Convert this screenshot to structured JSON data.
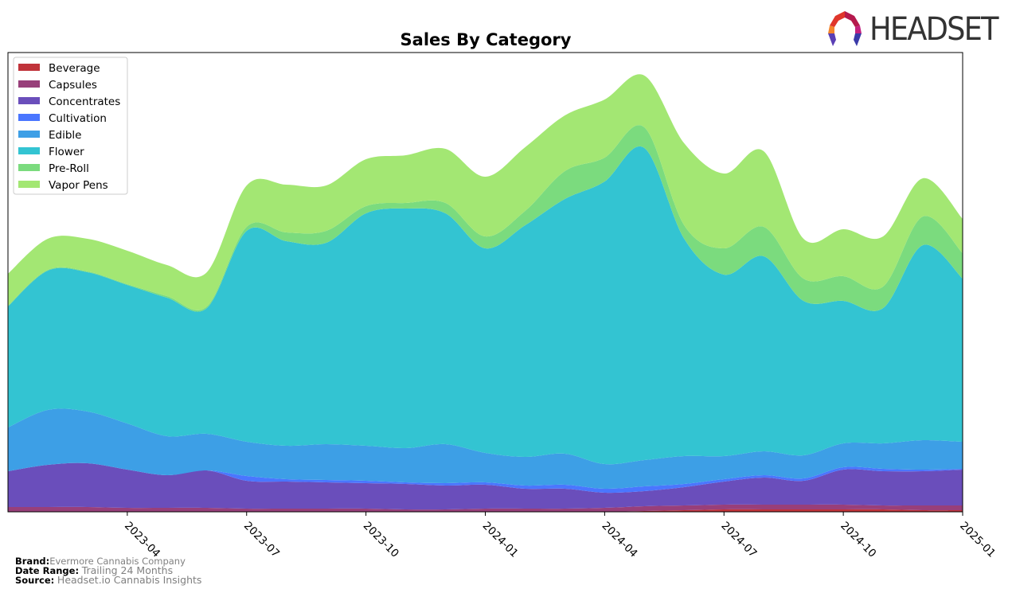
{
  "logo": {
    "text": "HEADSET",
    "icon": "headset-logo-icon"
  },
  "footer": {
    "brand_label": "Brand:",
    "brand_value": "Evermore Cannabis Company",
    "date_label": "Date Range:",
    "date_value": "Trailing 24 Months",
    "source_label": "Source:",
    "source_value": "Headset.io Cannabis Insights"
  },
  "chart_data": {
    "type": "area",
    "stacked": true,
    "title": "Sales By Category",
    "xlabel": "",
    "ylabel": "",
    "y_units": "relative (no y-axis shown)",
    "grid": false,
    "legend_position": "top-left",
    "x": [
      "2023-01",
      "2023-02",
      "2023-03",
      "2023-04",
      "2023-05",
      "2023-06",
      "2023-07",
      "2023-08",
      "2023-09",
      "2023-10",
      "2023-11",
      "2023-12",
      "2024-01",
      "2024-02",
      "2024-03",
      "2024-04",
      "2024-05",
      "2024-06",
      "2024-07",
      "2024-08",
      "2024-09",
      "2024-10",
      "2024-11",
      "2024-12",
      "2025-01"
    ],
    "x_tick_labels": [
      "2023-04",
      "2023-07",
      "2023-10",
      "2024-01",
      "2024-04",
      "2024-07",
      "2024-10",
      "2025-01"
    ],
    "ylim": [
      0,
      577
    ],
    "series": [
      {
        "name": "Beverage",
        "color": "#c0333a",
        "values": [
          0,
          0,
          0,
          0,
          0,
          0,
          0,
          0,
          0,
          0,
          0,
          0,
          0,
          0,
          0,
          0,
          1,
          2,
          3,
          3,
          3,
          3,
          3,
          2,
          2
        ]
      },
      {
        "name": "Capsules",
        "color": "#983f7a",
        "values": [
          6,
          6,
          6,
          5,
          5,
          5,
          4,
          4,
          4,
          4,
          3,
          3,
          4,
          4,
          4,
          5,
          6,
          6,
          6,
          6,
          6,
          6,
          5,
          6,
          6
        ]
      },
      {
        "name": "Concentrates",
        "color": "#6a4ebb",
        "values": [
          45,
          53,
          55,
          48,
          41,
          47,
          35,
          34,
          33,
          32,
          32,
          30,
          30,
          25,
          25,
          19,
          19,
          23,
          29,
          34,
          30,
          44,
          43,
          43,
          45
        ]
      },
      {
        "name": "Cultivation",
        "color": "#4a76ff",
        "values": [
          0,
          0,
          0,
          0,
          0,
          0,
          6,
          3,
          3,
          3,
          2,
          3,
          3,
          4,
          5,
          5,
          6,
          4,
          3,
          3,
          3,
          3,
          3,
          2,
          1
        ]
      },
      {
        "name": "Edible",
        "color": "#3d9fe6",
        "values": [
          55,
          69,
          65,
          58,
          49,
          46,
          43,
          42,
          45,
          44,
          43,
          49,
          37,
          36,
          39,
          31,
          33,
          35,
          29,
          30,
          29,
          30,
          32,
          37,
          34
        ]
      },
      {
        "name": "Flower",
        "color": "#33c4d2",
        "values": [
          152,
          175,
          175,
          174,
          174,
          158,
          265,
          257,
          253,
          292,
          301,
          290,
          257,
          291,
          320,
          355,
          392,
          273,
          228,
          245,
          194,
          179,
          170,
          245,
          205
        ]
      },
      {
        "name": "Pre-Roll",
        "color": "#7bdb7e",
        "values": [
          1,
          1,
          1,
          1,
          2,
          2,
          5,
          11,
          15,
          9,
          7,
          13,
          15,
          18,
          35,
          30,
          26,
          17,
          33,
          37,
          28,
          31,
          27,
          36,
          32
        ]
      },
      {
        "name": "Vapor Pens",
        "color": "#a3e773",
        "values": [
          40,
          39,
          41,
          42,
          39,
          43,
          52,
          60,
          57,
          59,
          60,
          68,
          75,
          80,
          70,
          73,
          65,
          103,
          94,
          95,
          50,
          59,
          63,
          48,
          43
        ]
      }
    ]
  }
}
